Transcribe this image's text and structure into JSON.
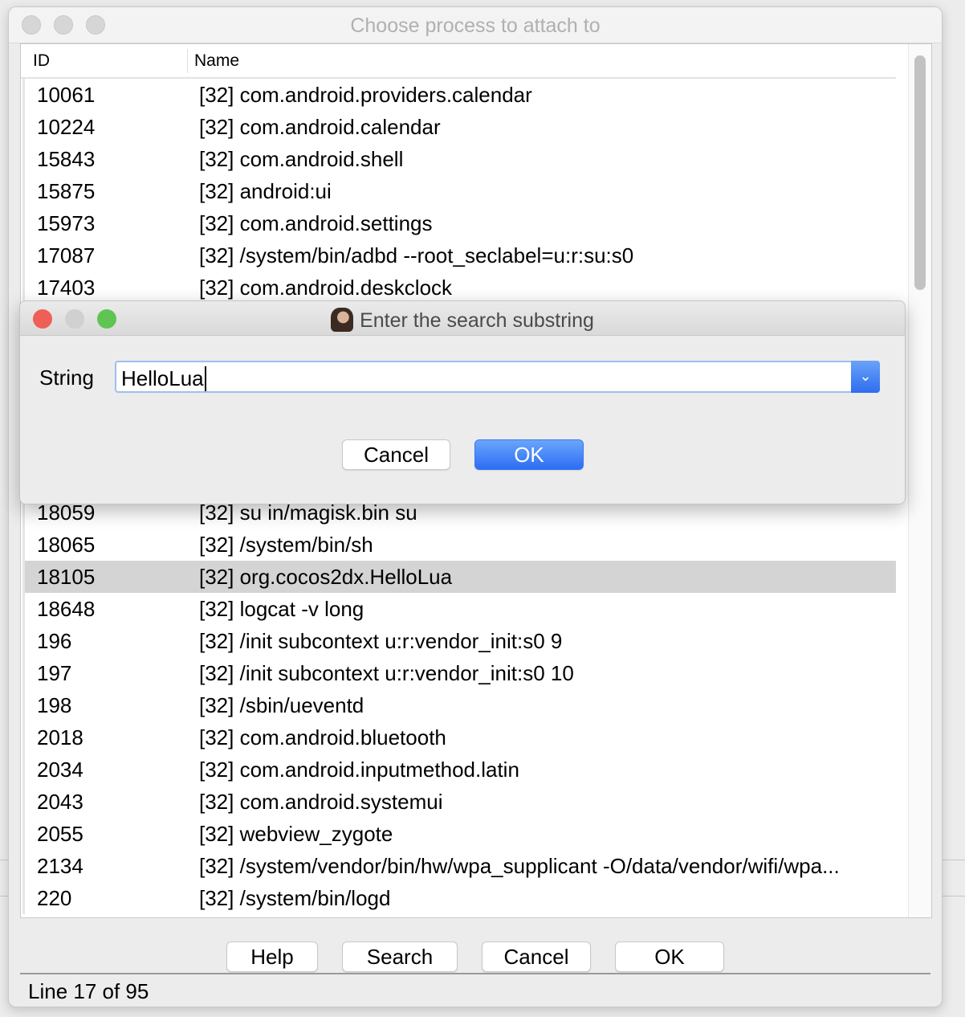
{
  "window": {
    "title": "Choose process to attach to"
  },
  "table": {
    "columns": [
      "ID",
      "Name"
    ],
    "rows_top": [
      {
        "id": "10061",
        "name": "[32] com.android.providers.calendar"
      },
      {
        "id": "10224",
        "name": "[32] com.android.calendar"
      },
      {
        "id": "15843",
        "name": "[32] com.android.shell"
      },
      {
        "id": "15875",
        "name": "[32] android:ui"
      },
      {
        "id": "15973",
        "name": "[32] com.android.settings"
      },
      {
        "id": "17087",
        "name": "[32] /system/bin/adbd --root_seclabel=u:r:su:s0"
      },
      {
        "id": "17403",
        "name": "[32] com.android.deskclock"
      }
    ],
    "rows_bottom": [
      {
        "id": "18059",
        "name": "[32] su in/magisk.bin su"
      },
      {
        "id": "18065",
        "name": "[32] /system/bin/sh"
      },
      {
        "id": "18105",
        "name": "[32] org.cocos2dx.HelloLua",
        "selected": true
      },
      {
        "id": "18648",
        "name": "[32] logcat -v long"
      },
      {
        "id": "196",
        "name": "[32] /init subcontext u:r:vendor_init:s0 9"
      },
      {
        "id": "197",
        "name": "[32] /init subcontext u:r:vendor_init:s0 10"
      },
      {
        "id": "198",
        "name": "[32] /sbin/ueventd"
      },
      {
        "id": "2018",
        "name": "[32] com.android.bluetooth"
      },
      {
        "id": "2034",
        "name": "[32] com.android.inputmethod.latin"
      },
      {
        "id": "2043",
        "name": "[32] com.android.systemui"
      },
      {
        "id": "2055",
        "name": "[32] webview_zygote"
      },
      {
        "id": "2134",
        "name": "[32] /system/vendor/bin/hw/wpa_supplicant -O/data/vendor/wifi/wpa..."
      },
      {
        "id": "220",
        "name": "[32] /system/bin/logd"
      }
    ]
  },
  "buttons": {
    "help": "Help",
    "search": "Search",
    "cancel": "Cancel",
    "ok": "OK"
  },
  "status": "Line 17 of 95",
  "dialog": {
    "title": "Enter the search substring",
    "label": "String",
    "value": "HelloLua",
    "cancel": "Cancel",
    "ok": "OK"
  },
  "colors": {
    "accent": "#2f6df0",
    "selection": "#d4d4d4",
    "close": "#ee5f57",
    "minimize": "#d0d0d0",
    "zoom": "#5fc454"
  }
}
